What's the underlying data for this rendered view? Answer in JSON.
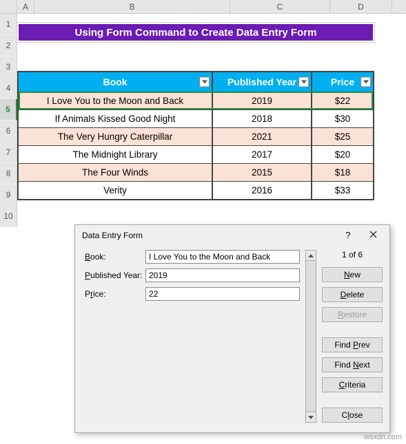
{
  "columns": [
    "A",
    "B",
    "C",
    "D"
  ],
  "rows": [
    "1",
    "2",
    "3",
    "4",
    "5",
    "6",
    "7",
    "8",
    "9",
    "10"
  ],
  "selectedRowIndex": 4,
  "title": "Using Form Command to Create Data Entry Form",
  "table": {
    "headers": {
      "book": "Book",
      "year": "Published Year",
      "price": "Price"
    },
    "rows": [
      {
        "book": "I Love You to the Moon and Back",
        "year": "2019",
        "price": "$22"
      },
      {
        "book": "If Animals Kissed Good Night",
        "year": "2018",
        "price": "$30"
      },
      {
        "book": "The Very Hungry Caterpillar",
        "year": "2021",
        "price": "$25"
      },
      {
        "book": "The Midnight Library",
        "year": "2017",
        "price": "$20"
      },
      {
        "book": "The Four Winds",
        "year": "2015",
        "price": "$18"
      },
      {
        "book": "Verity",
        "year": "2016",
        "price": "$33"
      }
    ]
  },
  "dialog": {
    "title": "Data Entry Form",
    "help": "?",
    "labels": {
      "book": "Book:",
      "year": "Published Year:",
      "price": "Price:",
      "book_u": "B",
      "year_u": "P",
      "price_u": "r"
    },
    "values": {
      "book": "I Love You to the Moon and Back",
      "year": "2019",
      "price": "22"
    },
    "counter": "1 of 6",
    "buttons": {
      "new": "New",
      "delete": "Delete",
      "restore": "Restore",
      "findprev": "Find Prev",
      "findnext": "Find Next",
      "criteria": "Criteria",
      "close": "Close",
      "new_u": "N",
      "delete_u": "D",
      "restore_u": "R",
      "findprev_u": "P",
      "findnext_u": "N",
      "criteria_u": "C",
      "close_u": "l"
    }
  },
  "watermark": "wsxdn.com",
  "chart_data": {
    "type": "table",
    "columns": [
      "Book",
      "Published Year",
      "Price"
    ],
    "rows": [
      [
        "I Love You to the Moon and Back",
        2019,
        22
      ],
      [
        "If Animals Kissed Good Night",
        2018,
        30
      ],
      [
        "The Very Hungry Caterpillar",
        2021,
        25
      ],
      [
        "The Midnight Library",
        2017,
        20
      ],
      [
        "The Four Winds",
        2015,
        18
      ],
      [
        "Verity",
        2016,
        33
      ]
    ]
  }
}
